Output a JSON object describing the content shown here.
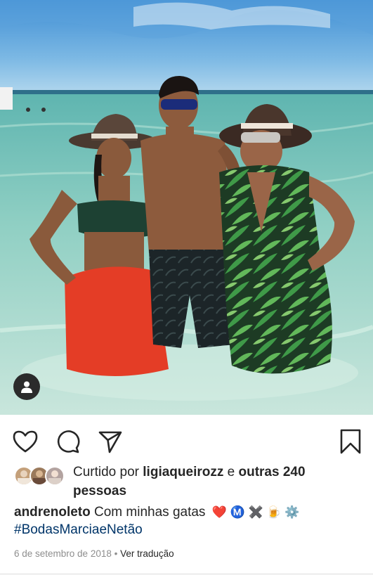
{
  "post": {
    "photo": {
      "description_icon": "beach-photo",
      "tag_icon": "person-icon"
    },
    "actions": {
      "like_icon": "heart-outline-icon",
      "comment_icon": "comment-bubble-icon",
      "share_icon": "paper-plane-icon",
      "save_icon": "bookmark-outline-icon"
    },
    "likes": {
      "prefix": "Curtido por",
      "liked_by_user": "ligiaqueirozz",
      "connector": "e",
      "others": "outras 240",
      "people": "pessoas"
    },
    "caption": {
      "username": "andrenoleto",
      "text": "Com minhas gatas",
      "emojis": "❤️ Ⓜ️ ✖️ 🍺 ⚙️",
      "hashtag": "#BodasMarciaeNetão"
    },
    "date": "6 de setembro de 2018",
    "separator": "•",
    "translate_label": "Ver tradução"
  },
  "colors": {
    "text": "#262626",
    "muted": "#8e8e8e",
    "hashtag": "#003569",
    "heart": "#e0245e"
  }
}
